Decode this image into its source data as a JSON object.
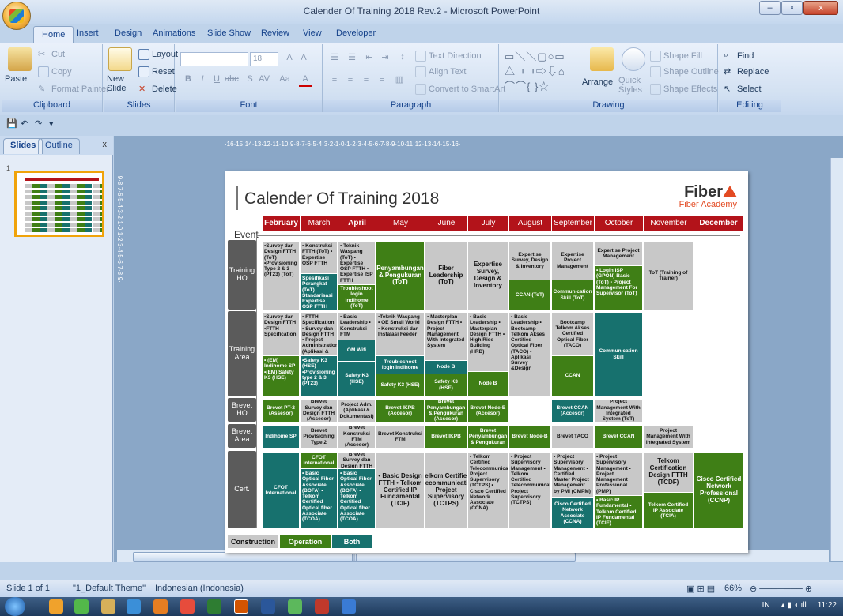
{
  "window": {
    "title": "Calender Of Training 2018 Rev.2 - Microsoft PowerPoint",
    "min": "–",
    "max": "▫",
    "close": "x"
  },
  "tabs": [
    "Home",
    "Insert",
    "Design",
    "Animations",
    "Slide Show",
    "Review",
    "View",
    "Developer"
  ],
  "ribbon": {
    "clipboard": {
      "paste": "Paste",
      "cut": "Cut",
      "copy": "Copy",
      "format_painter": "Format Painter",
      "label": "Clipboard"
    },
    "slides": {
      "new_slide": "New Slide",
      "layout": "Layout",
      "reset": "Reset",
      "delete": "Delete",
      "label": "Slides"
    },
    "font": {
      "size": "18",
      "label": "Font"
    },
    "paragraph": {
      "text_direction": "Text Direction",
      "align_text": "Align Text",
      "convert": "Convert to SmartArt",
      "label": "Paragraph"
    },
    "drawing": {
      "arrange": "Arrange",
      "quick_styles": "Quick Styles",
      "fill": "Shape Fill",
      "outline": "Shape Outline",
      "effects": "Shape Effects",
      "label": "Drawing"
    },
    "editing": {
      "find": "Find",
      "replace": "Replace",
      "select": "Select",
      "label": "Editing"
    }
  },
  "pane": {
    "slides_tab": "Slides",
    "outline_tab": "Outline",
    "close": "x",
    "slide_num": "1"
  },
  "ruler_h": "·16·15·14·13·12·11·10·9·8·7·6·5·4·3·2·1·0·1·2·3·4·5·6·7·8·9·10·11·12·13·14·15·16·",
  "ruler_v": "·9·8·7·6·5·4·3·2·1·0·1·2·3·4·5·6·7·8·9·",
  "slide": {
    "title": "Calender Of Training 2018",
    "brand": "Fiber",
    "brand_sub": "Fiber Academy",
    "event": "Event",
    "months": [
      "February",
      "March",
      "April",
      "May",
      "June",
      "July",
      "August",
      "September",
      "October",
      "November",
      "December"
    ],
    "rows": [
      "Training HO",
      "Training Area",
      "Brevet HO",
      "Brevet Area",
      "Cert."
    ],
    "cells": {
      "tho_feb": "•Survey dan Design FTTH (ToT) •Provisioning Type 2 & 3 (PT23) (ToT)",
      "tho_mar": "• Konstruksi FTTH (ToT) • Expertise OSP FTTH",
      "tho_mar2": "Spesifikasi Perangkat (ToT) Standarisasi Expertise OSP FTTH",
      "tho_apr": "• Teknik Waspang (ToT) • Expertise OSP FTTH • Expertise ISP FTTH",
      "tho_apr2": "Troubleshoot login indihome (ToT)",
      "tho_may": "Penyambungan & Pengukuran (ToT)",
      "tho_jun": "Fiber Leadership (ToT)",
      "tho_jul": "Expertise Survey, Design & Inventory",
      "tho_aug": "Expertise Survey, Design & Inventory",
      "tho_aug2": "CCAN (ToT)",
      "tho_sep": "Expertise Project Management",
      "tho_sep2": "Communication Skill (ToT)",
      "tho_oct": "Expertise Project Management",
      "tho_oct2": "• Login ISP (GPON) Basic (ToT) • Project Management For Supervisor (ToT)",
      "tho_nov": "ToT (Training of Trainer)",
      "tar_feb": "•Survey dan Design FTTH •FTTH Specification",
      "tar_feb2": "• (EM) Indihome SP •(EM) Safety K3 (HSE)",
      "tar_mar": "• FTTH Specification • Survey dan Design FTTH • Project Administration (Aplikasi & Dokumentasi)",
      "tar_mar2": "•Safety K3 (HSE) •Provisioning type 2 & 3 (PT23)",
      "tar_apr": "• Basic Leadership • Konstruksi FTM",
      "tar_apr2": "OM Wifi",
      "tar_apr3": "Safety K3 (HSE)",
      "tar_may": "•Teknik Waspang • OE Small World • Konstruksi dan Instalasi Feeder",
      "tar_may2": "Troubleshoot login Indihome",
      "tar_may3": "Safety K3 (HSE)",
      "tar_jun": "• Masterplan Design FTTH • Project Management With Integrated System",
      "tar_jun2": "Node B",
      "tar_jun3": "Safety K3 (HSE)",
      "tar_jul": "• Basic Leadership • Masterplan Design FTTH • High Rise Building (HRB)",
      "tar_jul2": "Node B",
      "tar_aug": "• Basic Leadership • Bootcamp Telkom Akses Certified Optical Fiber (TACO) • Aplikasi Survey &Design",
      "tar_sep": "Bootcamp Telkom Akses Certified Optical Fiber (TACO)",
      "tar_sep2": "CCAN",
      "tar_oct": "Communication Skill",
      "bho_feb": "Brevet PT-2 (Assesor)",
      "bho_mar": "Brevet Survey dan Design FTTH (Assesor)",
      "bho_apr": "Project Adm. (Aplikasi & Dokumentasi)",
      "bho_may": "Brevet IKPB (Accesor)",
      "bho_jun": "Brevet Penyambungan & Pengukuran (Assesor)",
      "bho_jul": "Brevet Node-B (Accesor)",
      "bho_sep": "Brevet CCAN (Accesor)",
      "bho_oct": "Project Management With Integrated System (ToT)",
      "bar_feb": "Indihome SP",
      "bar_mar": "Brevet Provisioning Type 2",
      "bar_apr": "Brevet Konstruksi FTM (Accesor)",
      "bar_may": "Brevet Konstruksi FTM",
      "bar_jun": "Brevet IKPB",
      "bar_jul": "Brevet Penyambungan & Pengukuran",
      "bar_aug": "Brevet Node-B",
      "bar_sep": "Brevet TACO",
      "bar_oct": "Brevet CCAN",
      "bar_nov": "Project Management With Integrated System",
      "cer_feb": "CFOT International",
      "cer_mar": "CFOT International",
      "cer_mar2": "• Basic Optical Fiber Associate (BOFA) • Telkom Certified Optical fiber Associate (TCOA)",
      "cer_apr": "Brevet Survey dan Design FTTH",
      "cer_apr2": "• Basic Optical Fiber Associate (BOFA) • Telkom Certified Optical fiber Associate (TCOA)",
      "cer_may": "• Basic Design FTTH • Telkom Certified IP Fundamental (TCIF)",
      "cer_jun": "Telkom Certified Telecommunication Project Supervisory (TCTPS)",
      "cer_jul": "• Telkom Certified Telecommunication Project Supervisory (TCTPS) • Cisco Certified Network Associate (CCNA)",
      "cer_aug": "• Project Supervisory Management • Telkom Certified Telecommunication Project Supervisory (TCTPS)",
      "cer_sep": "• Project Supervisory Management • Certified Master Project Management by PMI (CMPM)",
      "cer_sep2": "Cisco Certified Network Associate (CCNA)",
      "cer_oct": "• Project Supervisory Management • Project Management Professional (PMP)",
      "cer_oct2": "• Basic IP Fundamental • Telkom Certified IP Fundamental (TCIF)",
      "cer_nov": "Telkom Certification Design FTTH (TCDF)",
      "cer_nov2": "Telkom Certified IP Associate (TCIA)",
      "cer_dec": "Cisco Certified Network Professional (CCNP)"
    },
    "legend": [
      "Construction",
      "Operation",
      "Both"
    ]
  },
  "status": {
    "slide": "Slide 1 of 1",
    "theme": "\"1_Default Theme\"",
    "lang": "Indonesian (Indonesia)",
    "zoom": "66%"
  },
  "taskbar": {
    "lang": "IN",
    "time": "11:22"
  },
  "colors": {
    "accent_red": "#b3131a",
    "operation_green": "#3f7f16",
    "both_teal": "#17716e",
    "construction_grey": "#c8c8c8"
  }
}
